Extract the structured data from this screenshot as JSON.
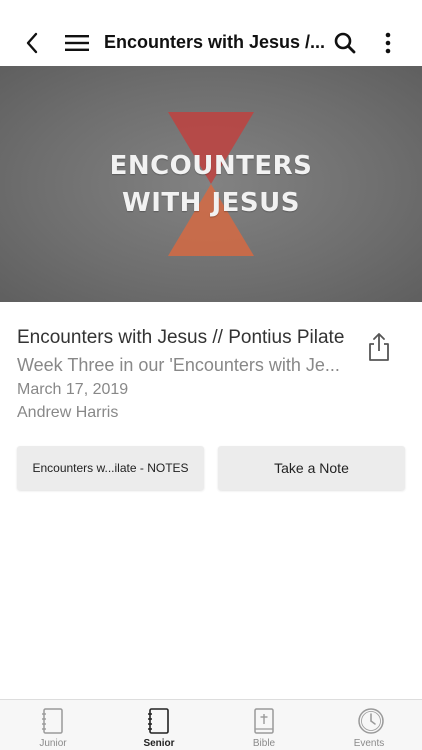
{
  "header": {
    "title": "Encounters with Jesus /...",
    "back_icon": "chevron-left-icon",
    "menu_icon": "hamburger-menu-icon",
    "search_icon": "search-icon",
    "more_icon": "more-vertical-icon"
  },
  "hero": {
    "line1": "ENCOUNTERS",
    "line2": "WITH JESUS",
    "accent_top": "#c0423f",
    "accent_bottom": "#d56a43"
  },
  "sermon": {
    "title": "Encounters with Jesus // Pontius Pilate",
    "subtitle": "Week Three in our 'Encounters with Je...",
    "date": "March 17, 2019",
    "speaker": "Andrew Harris",
    "share_icon": "share-icon"
  },
  "actions": {
    "notes_label": "Encounters w...ilate - NOTES",
    "take_note_label": "Take a Note"
  },
  "tabs": [
    {
      "label": "Junior",
      "icon": "notebook-icon",
      "active": false
    },
    {
      "label": "Senior",
      "icon": "notebook-icon",
      "active": true
    },
    {
      "label": "Bible",
      "icon": "bible-icon",
      "active": false
    },
    {
      "label": "Events",
      "icon": "clock-icon",
      "active": false
    }
  ]
}
